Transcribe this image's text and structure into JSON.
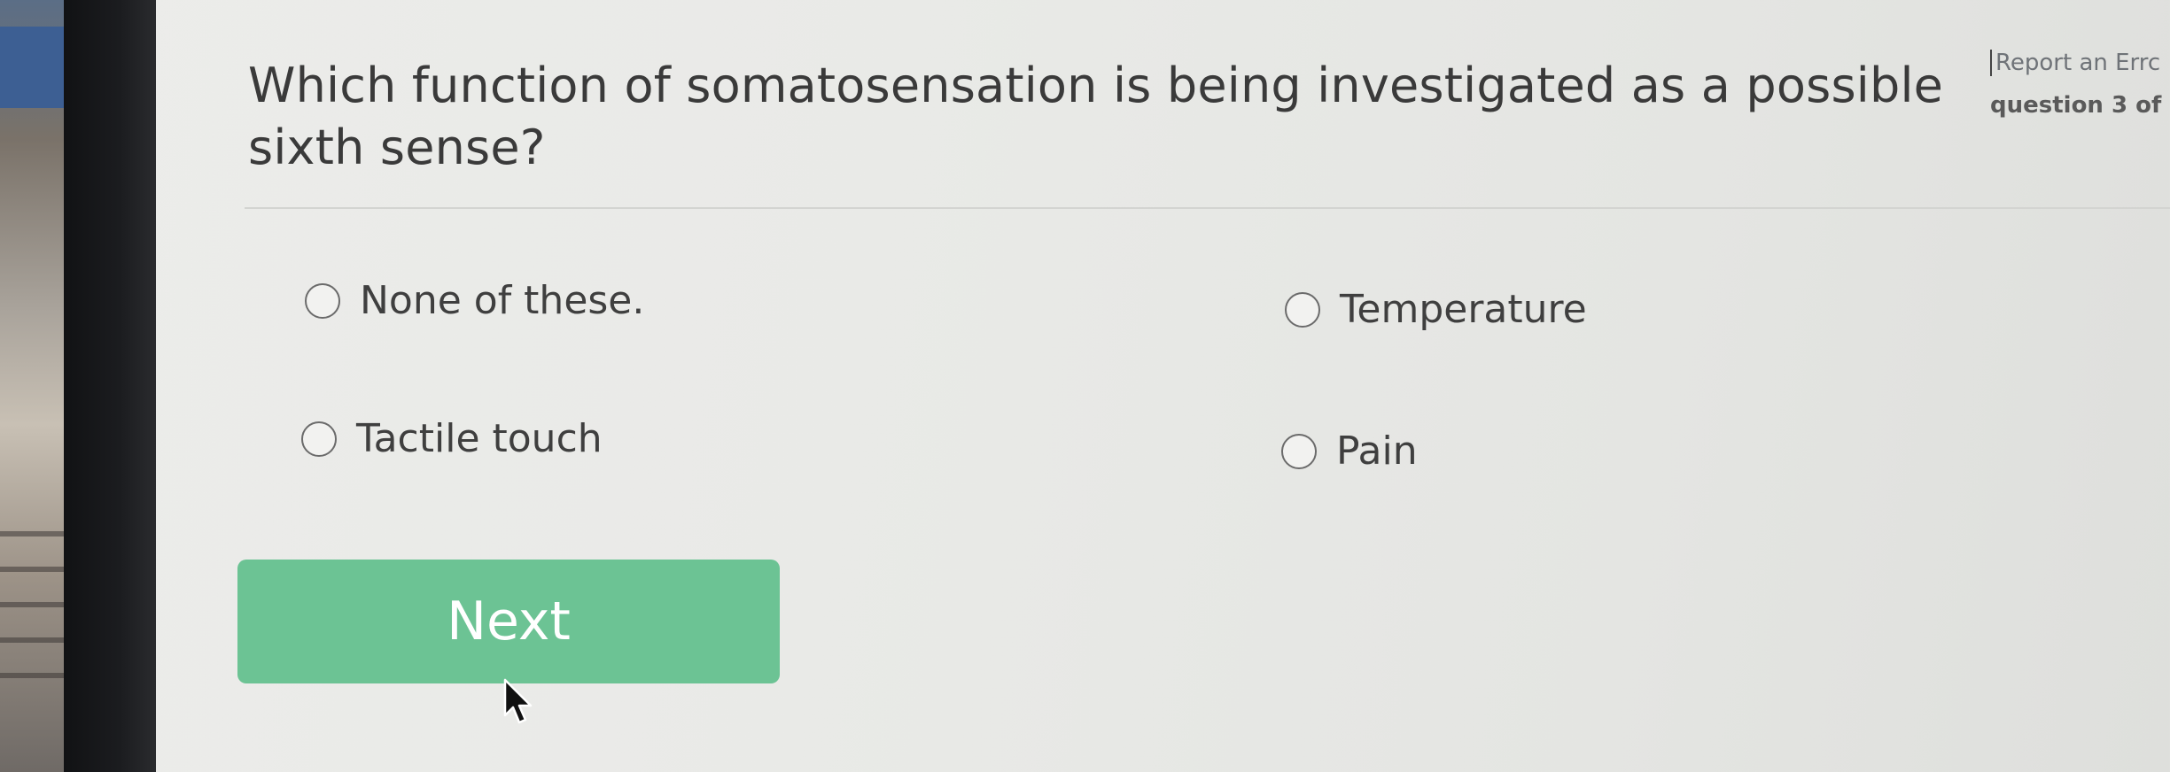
{
  "question": {
    "text": "Which function of somatosensation is being investigated as a possible sixth sense?"
  },
  "side_panel": {
    "report_link": "Report an Errc",
    "question_counter": "question 3 of"
  },
  "options": [
    {
      "label": "None of these.",
      "selected": false
    },
    {
      "label": "Temperature",
      "selected": false
    },
    {
      "label": "Tactile touch",
      "selected": false
    },
    {
      "label": "Pain",
      "selected": false
    }
  ],
  "actions": {
    "next_label": "Next"
  },
  "colors": {
    "next_button": "#6cc394",
    "text": "#3a3a3a",
    "background": "#ebebe8"
  },
  "icons": {
    "radio": "radio-empty-icon",
    "cursor": "mouse-pointer-icon"
  }
}
